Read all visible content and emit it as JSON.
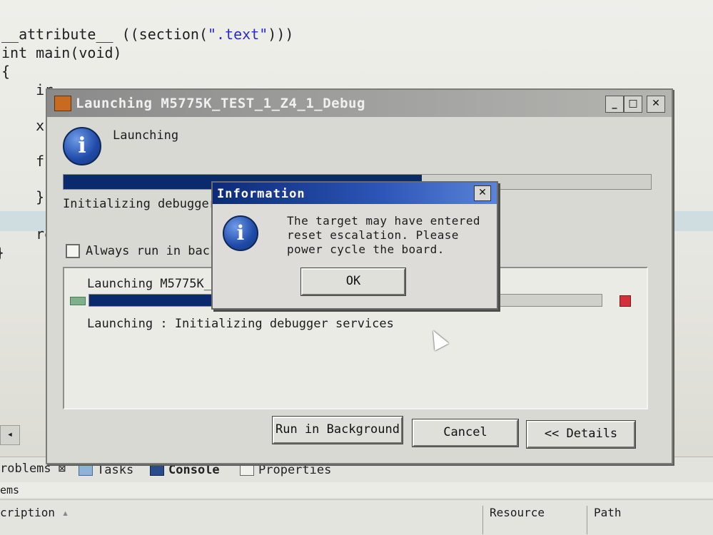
{
  "editor": {
    "lines": [
      {
        "text": "__attribute__ ((section(",
        "str": "\".text\"",
        "tail": ")))"
      },
      {
        "text": "int main(void)"
      },
      {
        "text": "{"
      },
      {
        "text": "    ir"
      },
      {
        "text": "    xc"
      },
      {
        "text": "    fc"
      },
      {
        "text": "    }"
      },
      {
        "text": "    re"
      },
      {
        "text": "}"
      }
    ]
  },
  "launch_dialog": {
    "title": "Launching M5775K_TEST_1_Z4_1_Debug",
    "heading": "Launching",
    "progress": 0.61,
    "status": "Initializing debugger",
    "checkbox_label": "Always run in back",
    "checkbox_checked": false,
    "jobs": {
      "job_title": "Launching M5775K_",
      "job_progress": 0.59,
      "job_status": "Launching : Initializing debugger services"
    },
    "buttons": {
      "run_in_background": "Run in Background",
      "cancel": "Cancel",
      "details": "<< Details"
    }
  },
  "info_dialog": {
    "title": "Information",
    "message_lines": [
      "The target may have entered",
      "reset escalation. Please",
      "power cycle the board."
    ],
    "ok_label": "OK"
  },
  "bottom": {
    "tabs": [
      "roblems",
      "Tasks",
      "Console",
      "Properties"
    ],
    "items_label": "ems",
    "columns": [
      "cription",
      "Resource",
      "Path"
    ]
  },
  "colors": {
    "progress_fill": "#0b2a6e",
    "info_title_bar": "#0c2a78",
    "stop": "#d4303a"
  }
}
